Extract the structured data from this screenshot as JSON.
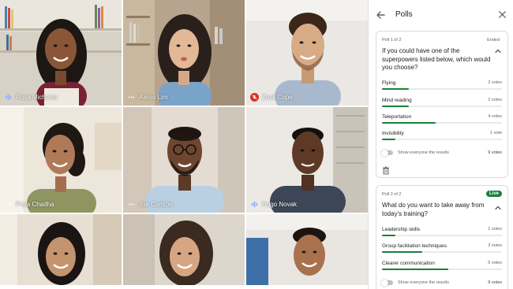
{
  "participants": [
    {
      "name": "Rosa Michaels",
      "audio": "speaking",
      "icon": "audio-level-icon"
    },
    {
      "name": "Alexis Lim",
      "audio": "idle",
      "icon": "more-dots-icon"
    },
    {
      "name": "Zack Cope",
      "audio": "muted",
      "icon": "mic-off-icon"
    },
    {
      "name": "Priya Chadha",
      "audio": "idle",
      "icon": "more-dots-icon"
    },
    {
      "name": "Joe Carlson",
      "audio": "idle",
      "icon": "more-dots-icon"
    },
    {
      "name": "Hugo Novak",
      "audio": "speaking",
      "icon": "audio-level-icon"
    },
    {
      "name": "",
      "audio": "",
      "icon": ""
    },
    {
      "name": "",
      "audio": "",
      "icon": ""
    },
    {
      "name": "",
      "audio": "",
      "icon": ""
    }
  ],
  "panel": {
    "title": "Polls",
    "back_icon": "arrow-back-icon",
    "close_icon": "close-icon"
  },
  "polls": [
    {
      "index_label": "Poll 1 of 2",
      "status": "Ended",
      "question": "If you could have one of the superpowers listed below, which would you choose?",
      "options": [
        {
          "label": "Flying",
          "votes_label": "2 votes",
          "votes": 2
        },
        {
          "label": "Mind reading",
          "votes_label": "2 votes",
          "votes": 2
        },
        {
          "label": "Teleportation",
          "votes_label": "4 votes",
          "votes": 4
        },
        {
          "label": "Invisibility",
          "votes_label": "1 vote",
          "votes": 1
        }
      ],
      "show_results_label": "Show everyone the results",
      "show_results_on": false,
      "total_label": "9 votes",
      "total": 9
    },
    {
      "index_label": "Poll 2 of 2",
      "status": "Live",
      "question": "What do you want to take away from today's training?",
      "options": [
        {
          "label": "Leadership skills",
          "votes_label": "1 votes",
          "votes": 1
        },
        {
          "label": "Group facilitation techniques",
          "votes_label": "3 votes",
          "votes": 3
        },
        {
          "label": "Clearer communication",
          "votes_label": "5 votes",
          "votes": 5
        }
      ],
      "show_results_label": "Show everyone the results",
      "show_results_on": false,
      "total_label": "9 votes",
      "total": 9
    }
  ],
  "colors": {
    "bar_fill": "#188038",
    "bar_track": "#e8eaed",
    "live_badge": "#188038",
    "muted_badge": "#d93025"
  }
}
